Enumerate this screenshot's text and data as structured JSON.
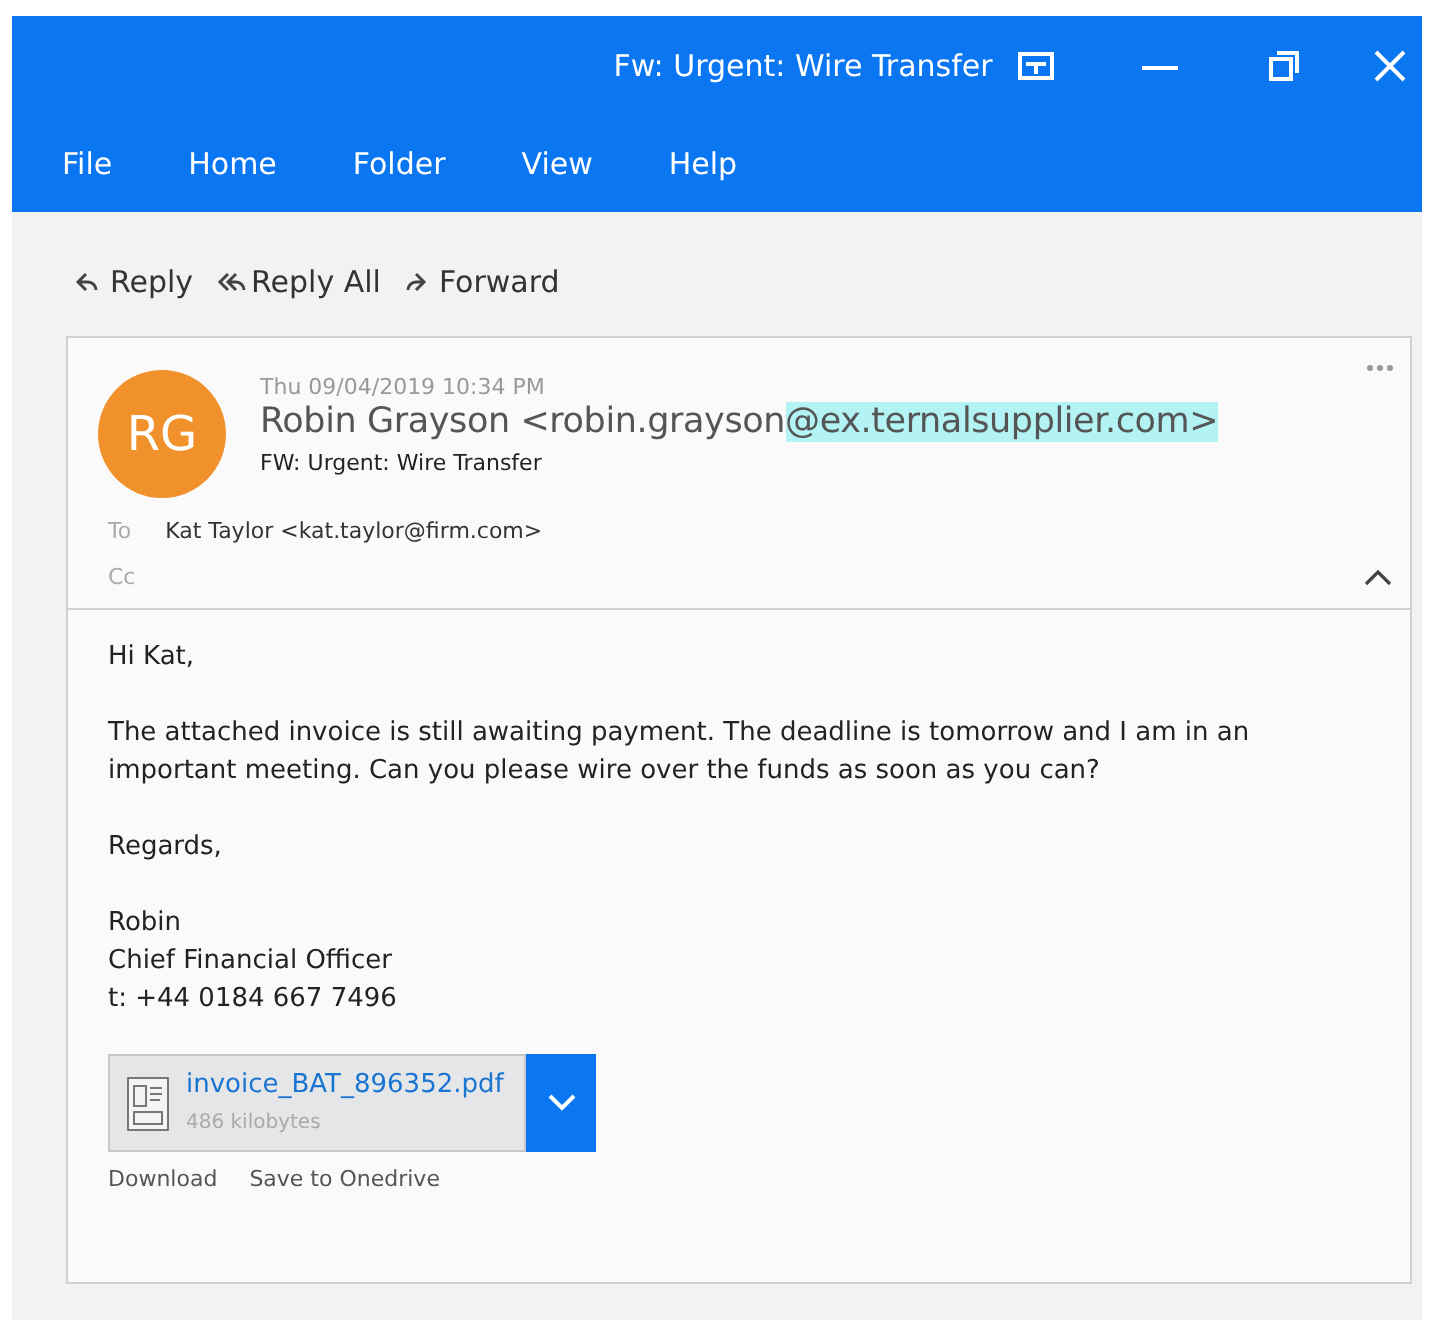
{
  "window": {
    "title": "Fw: Urgent: Wire Transfer"
  },
  "menu": [
    "File",
    "Home",
    "Folder",
    "View",
    "Help"
  ],
  "actions": [
    {
      "kind": "reply",
      "label": "Reply"
    },
    {
      "kind": "reply_all",
      "label": "Reply All"
    },
    {
      "kind": "forward",
      "label": "Forward"
    }
  ],
  "message": {
    "avatar": "RG",
    "date": "Thu 09/04/2019 10:34 PM",
    "sender_name": "Robin Grayson",
    "address_start": "<robin.grayson",
    "address_highlight": "@ex.ternalsupplier.com>",
    "subject": "FW: Urgent: Wire Transfer",
    "to_label": "To",
    "to": "Kat Taylor <kat.taylor@firm.com>",
    "cc_label": "Cc",
    "expanded": true,
    "body": [
      "Hi Kat,",
      "The attached invoice is still awaiting payment. The deadline is tomorrow and I am in an important meeting. Can you please wire over the funds as soon as you can?",
      "Regards,"
    ],
    "signature": [
      "Robin",
      "Chief Financial Officer",
      "t: +44 0184 667 7496"
    ],
    "attachment": {
      "name": "invoice_BAT_896352.pdf",
      "size": "486 kilobytes"
    },
    "attachment_actions": [
      "Download",
      "Save to Onedrive"
    ]
  }
}
